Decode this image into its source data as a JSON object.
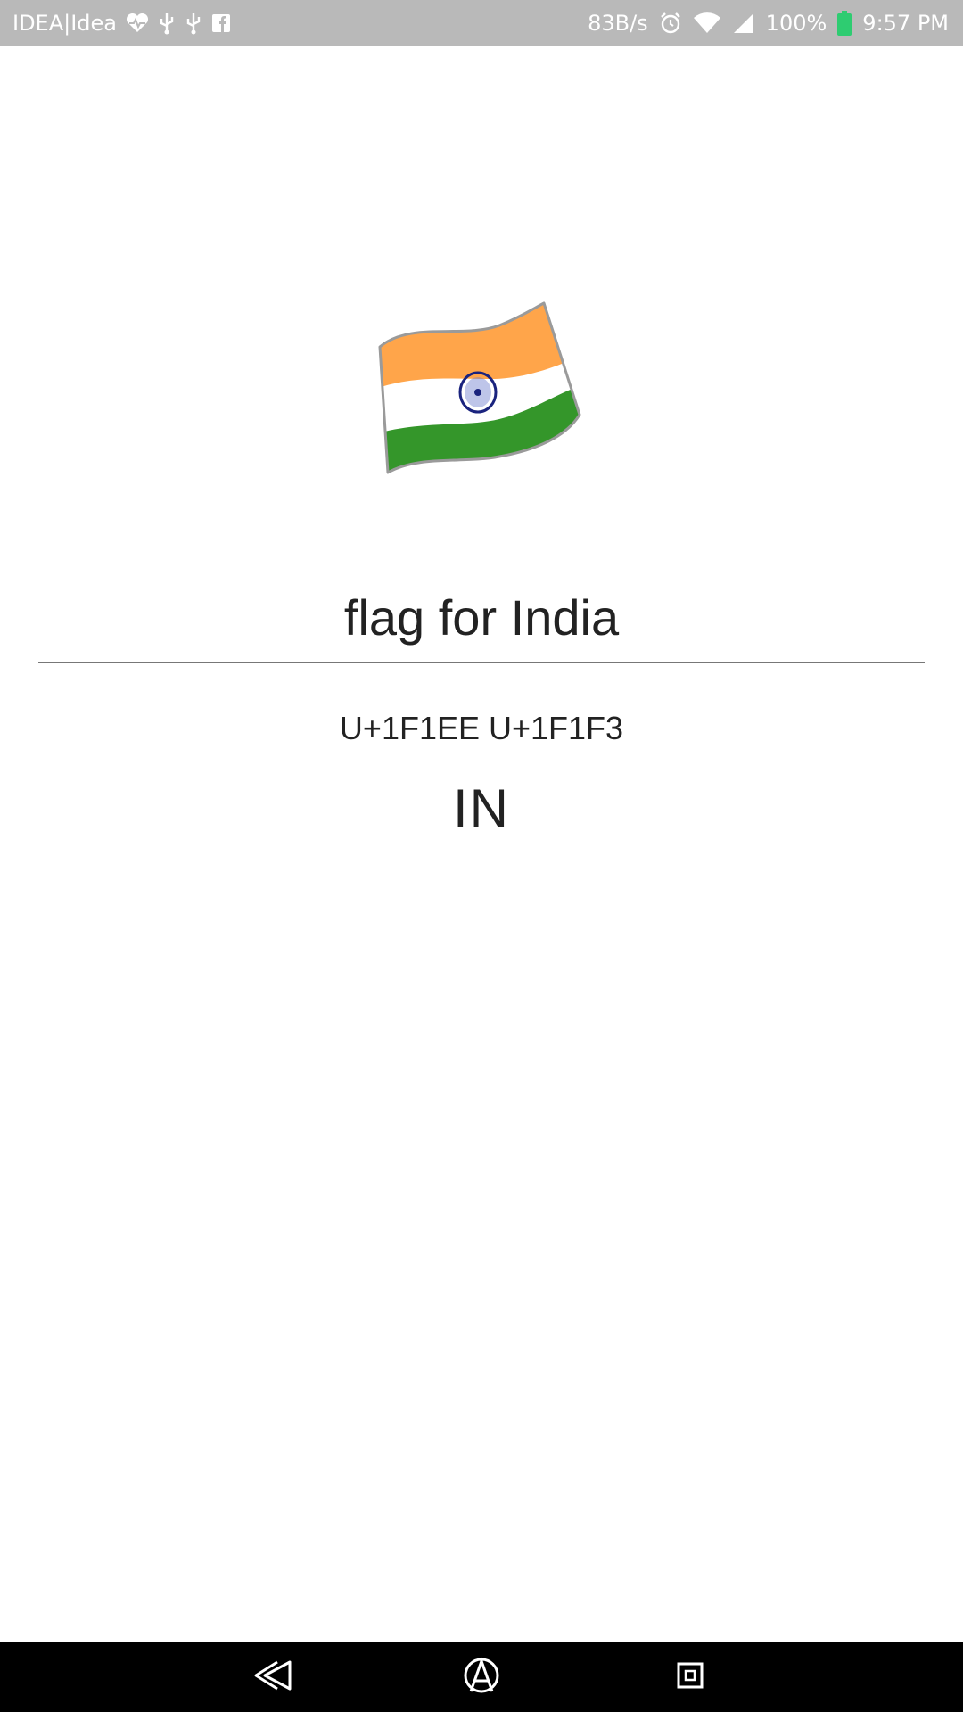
{
  "status_bar": {
    "carrier": "IDEA|Idea",
    "net_speed": "83B/s",
    "battery": "100%",
    "time": "9:57 PM",
    "icons": [
      "heart-pulse-icon",
      "usb-icon",
      "usb-icon",
      "facebook-icon",
      "alarm-icon",
      "wifi-icon",
      "signal-icon",
      "battery-icon"
    ],
    "battery_color": "#2ecc71"
  },
  "emoji": {
    "icon": "india-flag-icon",
    "colors": {
      "saffron": "#FFA54A",
      "white": "#FFFFFF",
      "green": "#34962A",
      "chakra": "#1A237E"
    }
  },
  "main": {
    "name": "flag for India",
    "codepoints": "U+1F1EE U+1F1F3",
    "code": "IN"
  },
  "nav_bar": {
    "icons": [
      "back-icon",
      "home-icon",
      "recents-icon"
    ]
  }
}
